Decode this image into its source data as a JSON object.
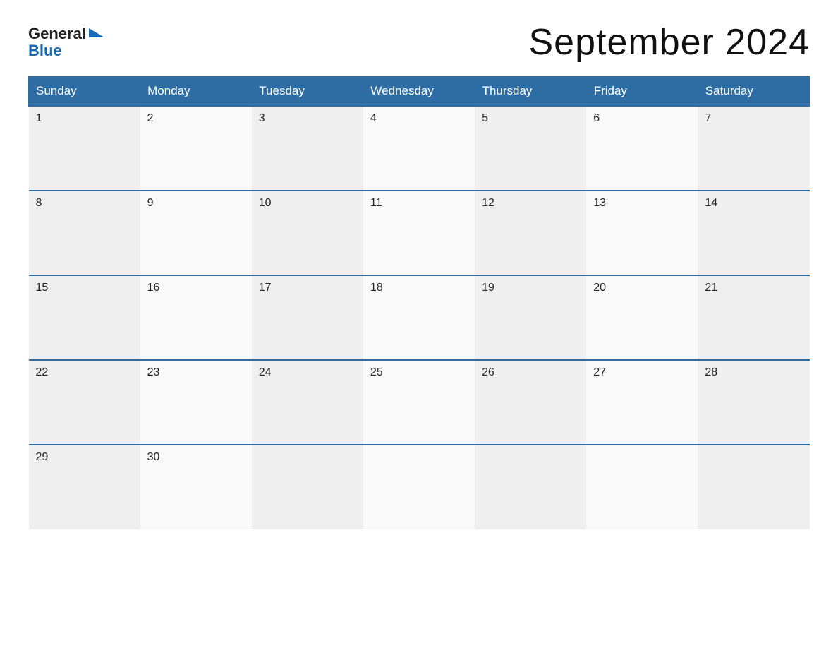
{
  "header": {
    "logo": {
      "general_text": "General",
      "blue_text": "Blue"
    },
    "title": "September 2024"
  },
  "calendar": {
    "weekdays": [
      "Sunday",
      "Monday",
      "Tuesday",
      "Wednesday",
      "Thursday",
      "Friday",
      "Saturday"
    ],
    "weeks": [
      [
        {
          "day": "1",
          "empty": false
        },
        {
          "day": "2",
          "empty": false
        },
        {
          "day": "3",
          "empty": false
        },
        {
          "day": "4",
          "empty": false
        },
        {
          "day": "5",
          "empty": false
        },
        {
          "day": "6",
          "empty": false
        },
        {
          "day": "7",
          "empty": false
        }
      ],
      [
        {
          "day": "8",
          "empty": false
        },
        {
          "day": "9",
          "empty": false
        },
        {
          "day": "10",
          "empty": false
        },
        {
          "day": "11",
          "empty": false
        },
        {
          "day": "12",
          "empty": false
        },
        {
          "day": "13",
          "empty": false
        },
        {
          "day": "14",
          "empty": false
        }
      ],
      [
        {
          "day": "15",
          "empty": false
        },
        {
          "day": "16",
          "empty": false
        },
        {
          "day": "17",
          "empty": false
        },
        {
          "day": "18",
          "empty": false
        },
        {
          "day": "19",
          "empty": false
        },
        {
          "day": "20",
          "empty": false
        },
        {
          "day": "21",
          "empty": false
        }
      ],
      [
        {
          "day": "22",
          "empty": false
        },
        {
          "day": "23",
          "empty": false
        },
        {
          "day": "24",
          "empty": false
        },
        {
          "day": "25",
          "empty": false
        },
        {
          "day": "26",
          "empty": false
        },
        {
          "day": "27",
          "empty": false
        },
        {
          "day": "28",
          "empty": false
        }
      ],
      [
        {
          "day": "29",
          "empty": false
        },
        {
          "day": "30",
          "empty": false
        },
        {
          "day": "",
          "empty": true
        },
        {
          "day": "",
          "empty": true
        },
        {
          "day": "",
          "empty": true
        },
        {
          "day": "",
          "empty": true
        },
        {
          "day": "",
          "empty": true
        }
      ]
    ]
  }
}
